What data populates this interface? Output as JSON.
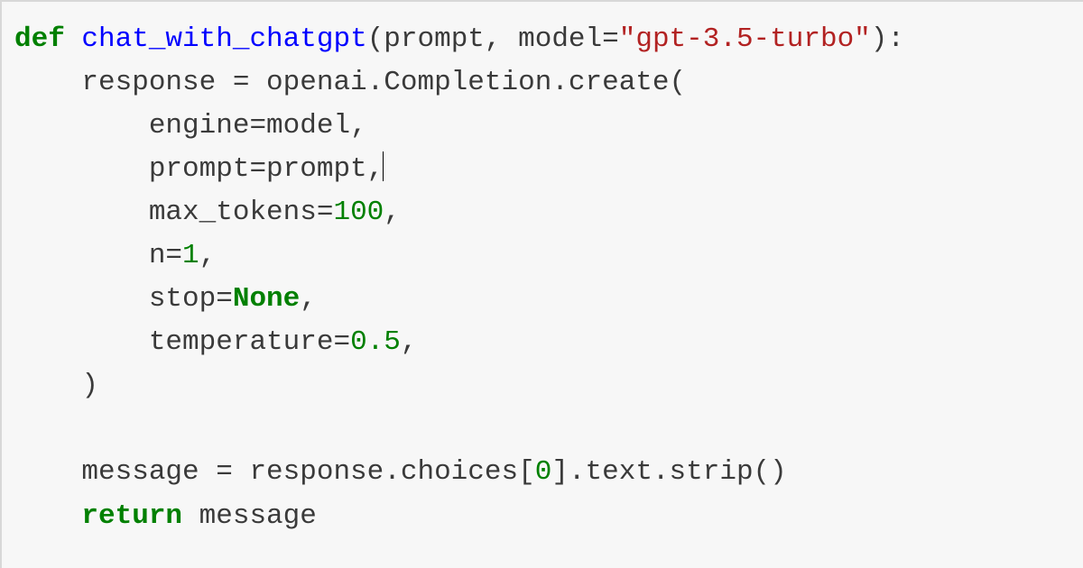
{
  "code": {
    "kw_def": "def",
    "fn_name": "chat_with_chatgpt",
    "params_open": "(prompt, model=",
    "default_model": "\"gpt-3.5-turbo\"",
    "params_close": "):",
    "l2": "    response = openai.Completion.create(",
    "l3a": "        engine=model",
    "comma": ",",
    "l4a": "        prompt=prompt",
    "l5a": "        max_tokens=",
    "l5n": "100",
    "l6a": "        n=",
    "l6n": "1",
    "l7a": "        stop=",
    "l7none": "None",
    "l8a": "        temperature=",
    "l8n": "0.5",
    "l9": "    )",
    "blank": "",
    "l11a": "    message = response.choices[",
    "l11n": "0",
    "l11b": "].text.strip()",
    "kw_return": "return",
    "l12b": " message",
    "indent1": "    "
  }
}
